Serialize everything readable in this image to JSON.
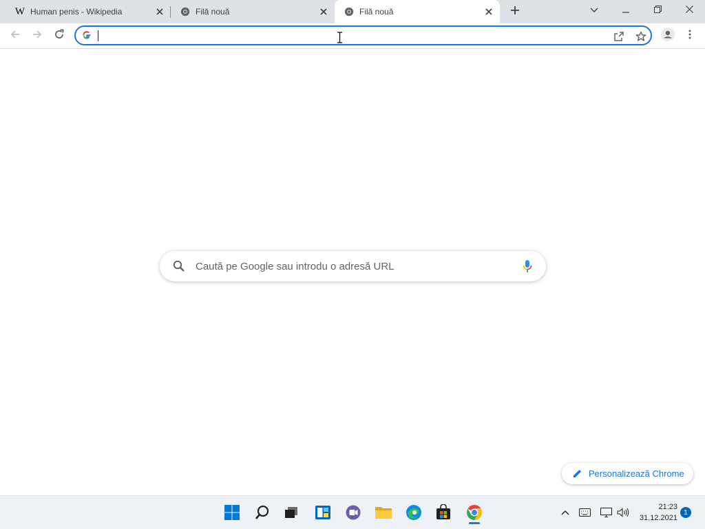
{
  "tabs": [
    {
      "title": "Human penis - Wikipedia",
      "favicon": "wikipedia-icon",
      "active": false
    },
    {
      "title": "Filă nouă",
      "favicon": "chrome-icon",
      "active": false
    },
    {
      "title": "Filă nouă",
      "favicon": "chrome-icon",
      "active": true
    }
  ],
  "omnibox": {
    "value": "",
    "placeholder": ""
  },
  "ntp": {
    "search_placeholder": "Caută pe Google sau introdu o adresă URL",
    "customize_label": "Personalizează Chrome"
  },
  "taskbar": {
    "apps": [
      "windows-start-icon",
      "search-icon",
      "task-view-icon",
      "widgets-icon",
      "teams-chat-icon",
      "file-explorer-icon",
      "edge-icon",
      "store-icon",
      "chrome-icon"
    ],
    "time": "21:23",
    "date": "31.12.2021",
    "notification_count": "1"
  },
  "colors": {
    "accent": "#1a73e8",
    "tabstrip": "#dee1e6",
    "taskbar": "#eef2f6"
  }
}
